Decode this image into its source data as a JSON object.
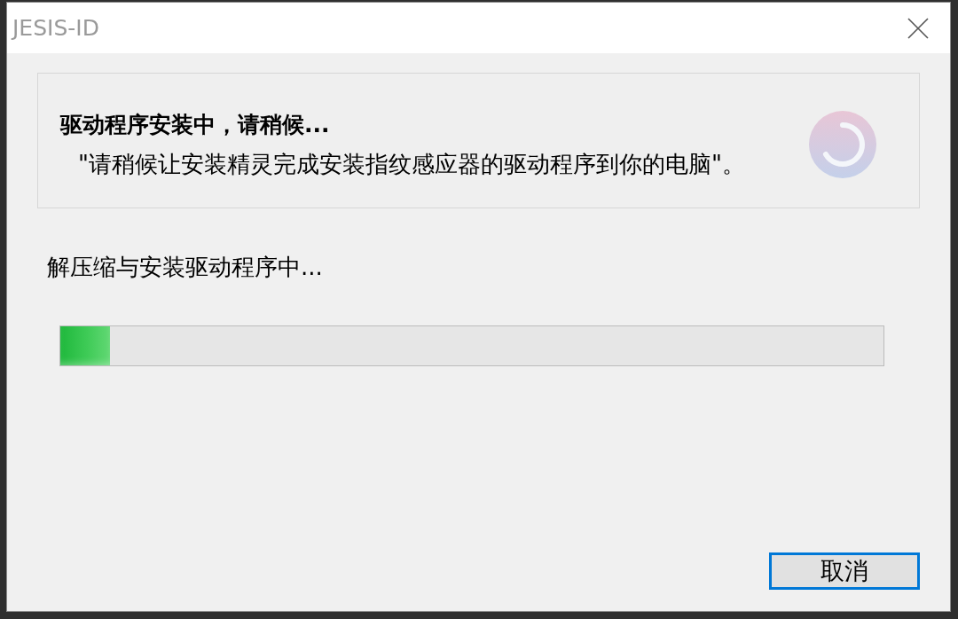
{
  "window": {
    "title": "JESIS-ID"
  },
  "header": {
    "title": "驱动程序安装中，请稍候...",
    "description": "\"请稍候让安装精灵完成安装指纹感应器的驱动程序到你的电脑\"。"
  },
  "status": "解压缩与安装驱动程序中...",
  "progress": {
    "level": 0.06
  },
  "buttons": [
    {
      "label": "取消",
      "focused": true
    }
  ]
}
